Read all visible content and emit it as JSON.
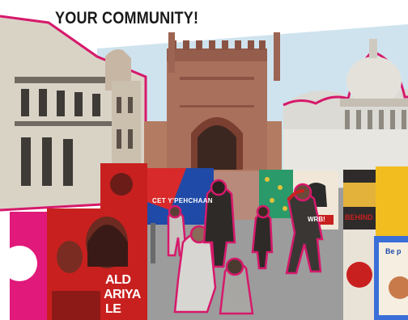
{
  "headline": "YOUR COMMUNITY!",
  "posters": {
    "blue_poster_text": "CET Y'PEHCHAAN",
    "red_poster_line1": "ALD",
    "red_poster_line2": "ARIYA",
    "red_poster_line3": "LE",
    "yellow_poster_text": "BEHIND",
    "small_red_sign": "WRB!",
    "right_blue_card": "Be p"
  },
  "colors": {
    "outline_magenta": "#d6196b",
    "sky": "#cfe3ee",
    "fort_stone": "#a9705c",
    "poster_red": "#c8201f",
    "poster_blue": "#1f4aa8"
  }
}
